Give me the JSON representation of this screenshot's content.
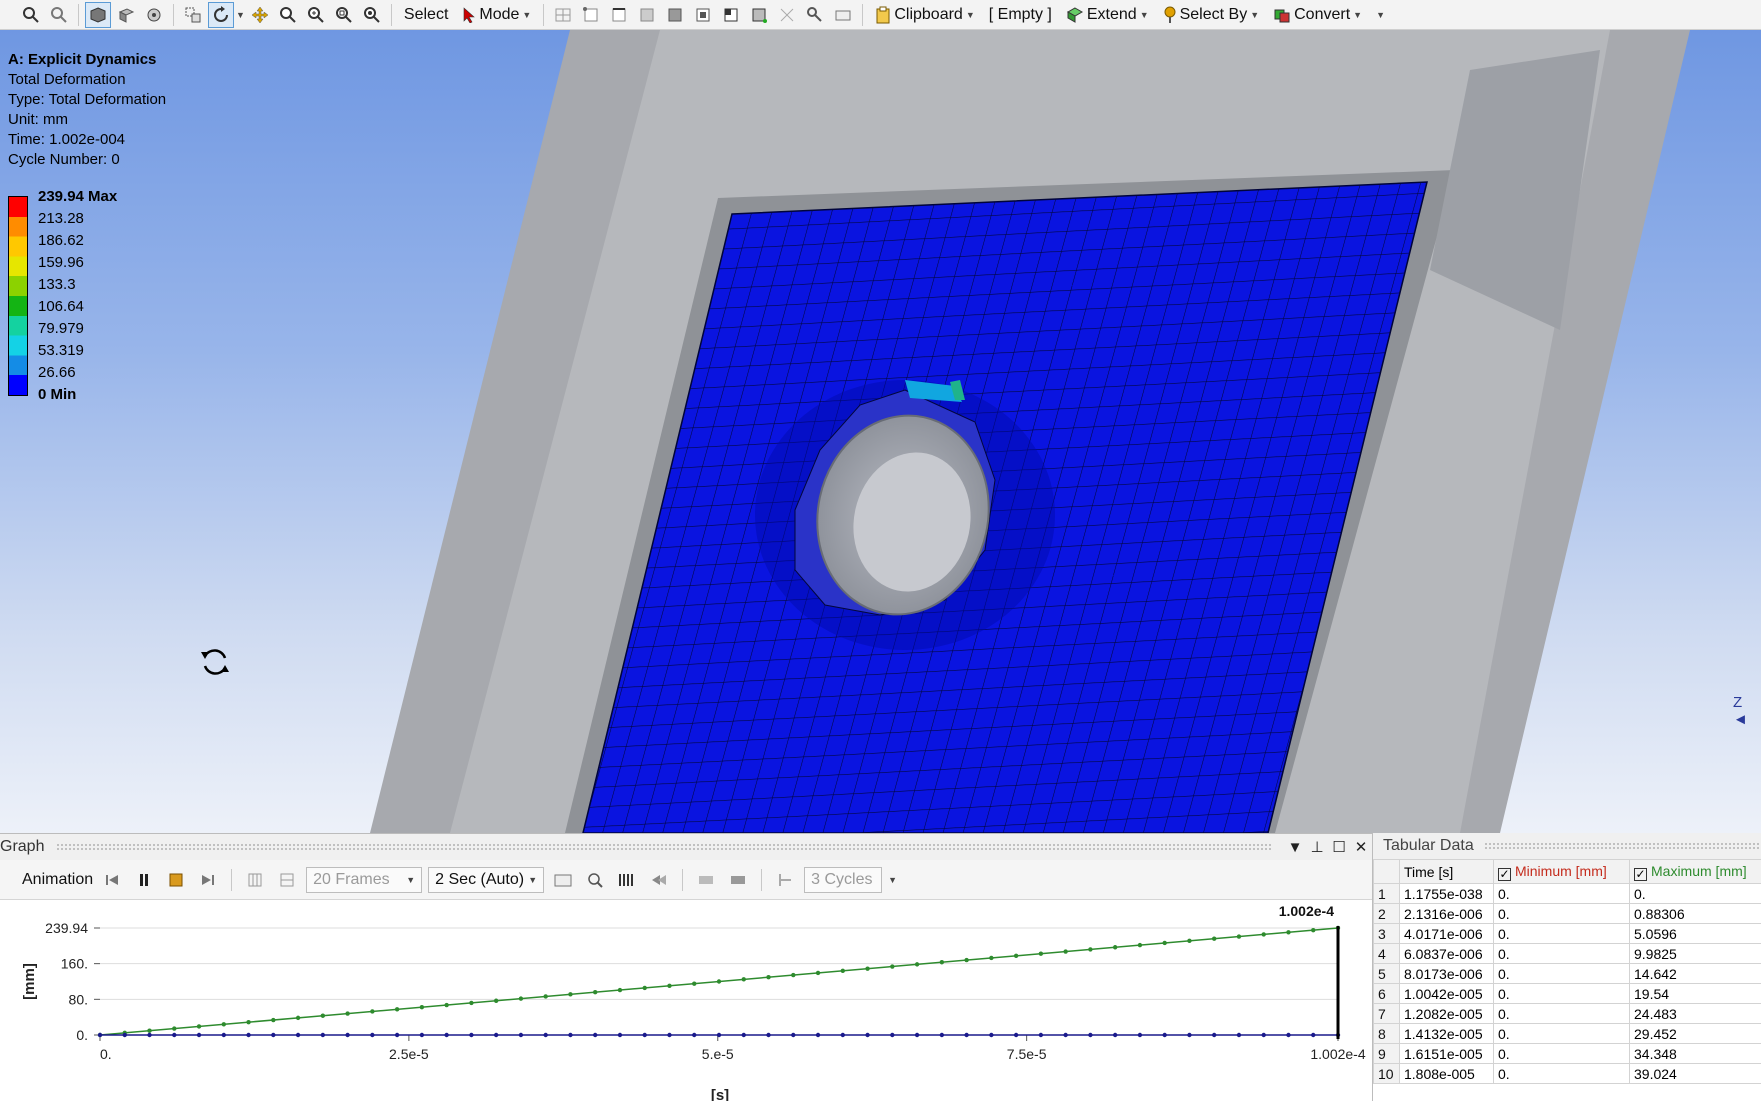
{
  "toolbar": {
    "select_label": "Select",
    "mode_label": "Mode",
    "clipboard_label": "Clipboard",
    "empty_label": "[ Empty ]",
    "extend_label": "Extend",
    "select_by_label": "Select By",
    "convert_label": "Convert"
  },
  "result_info": {
    "title": "A: Explicit Dynamics",
    "name": "Total Deformation",
    "type": "Type: Total Deformation",
    "unit": "Unit: mm",
    "time": "Time: 1.002e-004",
    "cycle": "Cycle Number: 0"
  },
  "legend": {
    "labels": [
      "239.94 Max",
      "213.28",
      "186.62",
      "159.96",
      "133.3",
      "106.64",
      "79.979",
      "53.319",
      "26.66",
      "0 Min"
    ],
    "colors": [
      "#ff0000",
      "#ff8c00",
      "#ffc800",
      "#e6e600",
      "#8cd200",
      "#14b414",
      "#14d2a0",
      "#14d2e6",
      "#148ce6",
      "#0000ff"
    ]
  },
  "axis_triad": {
    "z_label": "Z"
  },
  "graph": {
    "title": "Graph",
    "animation_label": "Animation",
    "frames": "20 Frames",
    "duration": "2 Sec (Auto)",
    "cycles": "3 Cycles",
    "chart_data": {
      "type": "line",
      "ylabel": "[mm]",
      "xlabel": "[s]",
      "x_tick_labels": [
        "0.",
        "2.5e-5",
        "5.e-5",
        "7.5e-5",
        "1.002e-4"
      ],
      "x_ticks": [
        0,
        2.5e-05,
        5e-05,
        7.5e-05,
        0.0001002
      ],
      "y_tick_labels": [
        "0.",
        "80.",
        "160.",
        "239.94"
      ],
      "y_ticks": [
        0,
        80,
        160,
        239.94
      ],
      "xlim": [
        0,
        0.0001002
      ],
      "ylim": [
        0,
        239.94
      ],
      "current_time_label": "1.002e-4",
      "current_time": 0.0001002,
      "series": [
        {
          "name": "Maximum [mm]",
          "color": "#2e8b2e",
          "x": [
            0,
            0.0001002
          ],
          "y": [
            0,
            239.94
          ]
        },
        {
          "name": "Minimum [mm]",
          "color": "#1a1a8c",
          "x": [
            0,
            0.0001002
          ],
          "y": [
            0,
            0
          ]
        }
      ],
      "marker_count": 50
    }
  },
  "tabular": {
    "title": "Tabular Data",
    "columns": [
      "Time [s]",
      "Minimum [mm]",
      "Maximum [mm]"
    ],
    "rows": [
      [
        "1",
        "1.1755e-038",
        "0.",
        "0."
      ],
      [
        "2",
        "2.1316e-006",
        "0.",
        "0.88306"
      ],
      [
        "3",
        "4.0171e-006",
        "0.",
        "5.0596"
      ],
      [
        "4",
        "6.0837e-006",
        "0.",
        "9.9825"
      ],
      [
        "5",
        "8.0173e-006",
        "0.",
        "14.642"
      ],
      [
        "6",
        "1.0042e-005",
        "0.",
        "19.54"
      ],
      [
        "7",
        "1.2082e-005",
        "0.",
        "24.483"
      ],
      [
        "8",
        "1.4132e-005",
        "0.",
        "29.452"
      ],
      [
        "9",
        "1.6151e-005",
        "0.",
        "34.348"
      ],
      [
        "10",
        "1.808e-005",
        "0.",
        "39.024"
      ]
    ]
  }
}
